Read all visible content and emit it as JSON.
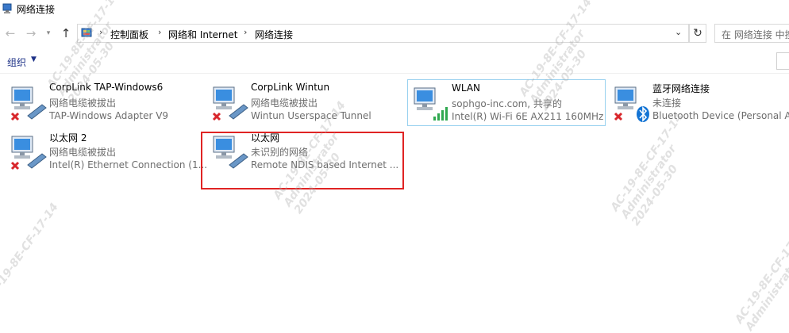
{
  "window": {
    "title": "网络连接"
  },
  "nav": {
    "breadcrumb": [
      "控制面板",
      "网络和 Internet",
      "网络连接"
    ],
    "search_placeholder": "在 网络连接 中搜索"
  },
  "toolbar": {
    "organize_label": "组织"
  },
  "connections": [
    {
      "name": "CorpLink TAP-Windows6",
      "status": "网络电缆被拔出",
      "device": "TAP-Windows Adapter V9",
      "state": "disconnected"
    },
    {
      "name": "CorpLink Wintun",
      "status": "网络电缆被拔出",
      "device": "Wintun Userspace Tunnel",
      "state": "disconnected"
    },
    {
      "name": "WLAN",
      "status": "sophgo-inc.com, 共享的",
      "device": "Intel(R) Wi-Fi 6E AX211 160MHz",
      "state": "wifi-connected"
    },
    {
      "name": "蓝牙网络连接",
      "status": "未连接",
      "device": "Bluetooth Device (Personal Area Network)",
      "state": "bluetooth-disconnected"
    },
    {
      "name": "以太网 2",
      "status": "网络电缆被拔出",
      "device": "Intel(R) Ethernet Connection (1...",
      "state": "disconnected"
    },
    {
      "name": "以太网",
      "status": "未识别的网络",
      "device": "Remote NDIS based Internet ...",
      "state": "connected"
    }
  ],
  "watermark": {
    "line1": "AC-19-8E-CF-17-14",
    "line2": "Administrator",
    "line3": "2024-05-30"
  },
  "colors": {
    "highlight": "#e02424",
    "link": "#1e3287",
    "selection_border": "#99d1ef"
  }
}
